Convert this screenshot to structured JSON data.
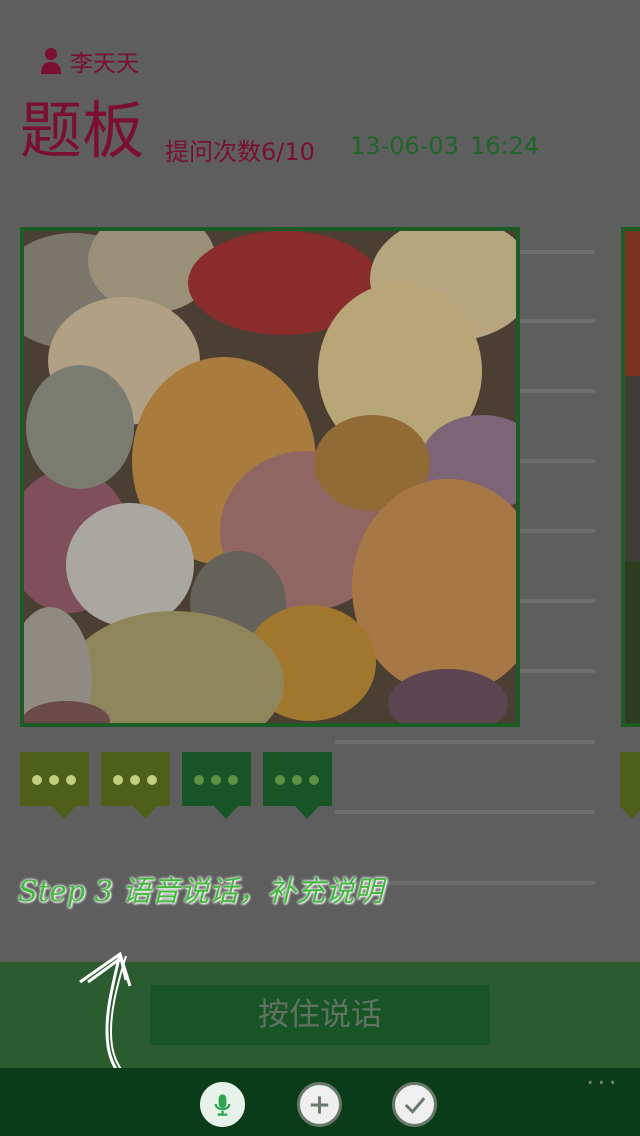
{
  "header": {
    "user_name": "李天天",
    "title": "题板",
    "question_count": "提问次数6/10",
    "date": "13-06-03",
    "time": "16:24"
  },
  "photo": {
    "image": "pebbles-photo"
  },
  "bubbles": [
    {
      "icon": "comment-dots-icon"
    },
    {
      "icon": "comment-dots-icon"
    },
    {
      "icon": "comment-dots-icon"
    },
    {
      "icon": "comment-dots-icon"
    }
  ],
  "annotation": {
    "text": "Step 3 语音说话，补充说明"
  },
  "speak_button": {
    "label": "按住说话"
  },
  "appbar": {
    "icons": [
      "microphone-icon",
      "add-icon",
      "check-icon"
    ],
    "more": "..."
  },
  "colors": {
    "title": "#7a0f2f",
    "green": "#1e6628",
    "accent": "#42b83f"
  }
}
